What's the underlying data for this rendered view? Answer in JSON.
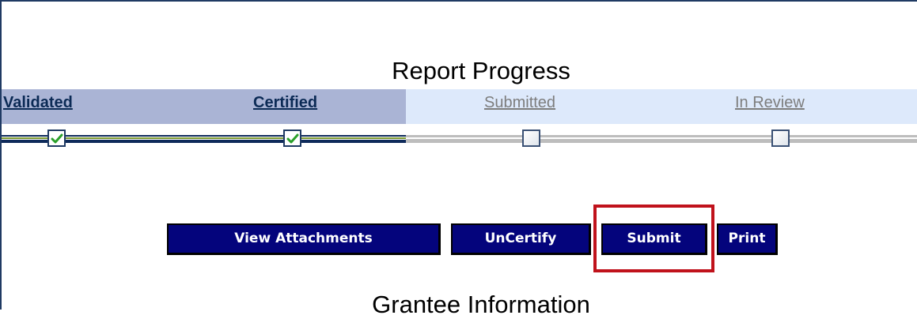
{
  "title": "Report Progress",
  "steps": [
    {
      "label": "Validated",
      "completed": true
    },
    {
      "label": "Certified",
      "completed": true
    },
    {
      "label": "Submitted",
      "completed": false
    },
    {
      "label": "In Review",
      "completed": false
    }
  ],
  "buttons": {
    "view_attachments": "View Attachments",
    "uncertify": "UnCertify",
    "submit": "Submit",
    "print": "Print"
  },
  "section_title": "Grantee Information",
  "colors": {
    "completed_band": "#aab4d5",
    "pending_band": "#dde9fb",
    "button_bg": "#04047c",
    "highlight": "#c0121b",
    "check": "#2aa02a"
  },
  "icons": {
    "check": "check-icon"
  }
}
